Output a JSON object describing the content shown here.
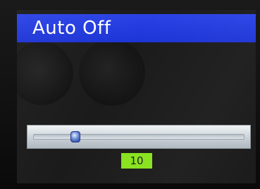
{
  "screen": {
    "title": "Auto Off"
  },
  "slider": {
    "value": 10,
    "level_fraction": 0.2
  },
  "value_display": {
    "text": "10"
  },
  "colors": {
    "title_bar": "#2a43e6",
    "value_box": "#88e21d"
  }
}
